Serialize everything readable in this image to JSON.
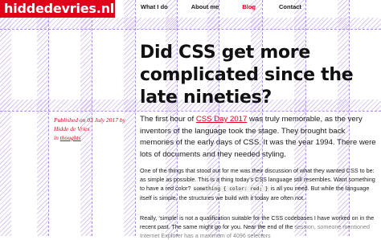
{
  "site": {
    "logo": "hiddedevries.nl"
  },
  "nav": {
    "items": [
      "What I do",
      "About me",
      "Blog",
      "Contact"
    ],
    "active": "Blog"
  },
  "article": {
    "title": "Did CSS get more complicated since the late nineties?",
    "meta": {
      "published_prefix": "Published on 03 July 2017 by Hidde de Vries",
      "category_prefix": "in ",
      "category": "thoughts"
    },
    "lead": {
      "before_link": "The first hour of ",
      "link": "CSS Day 2017",
      "after_link": " was truly memorable, as the very inventors of the language took the stage. They brought back memories of the early days of CSS. It was the year 1994. There were lots of documents and they needed styling."
    },
    "p2": {
      "before_code": "One of the things that stood out for me was their discussion of what they wanted CSS to be: as simple as possible. This is a thing today’s CSS language still resembles. Want something to have a red color? ",
      "code": "something { color: red; }",
      "after_code": " is all you need. But while the language itself is simple, the structures we build with it today are often not."
    },
    "p3": {
      "text": "Really, ‘simple’ is not a qualification suitable for the CSS codebases I have worked on in the recent past. The same might go for you. Near the end of the",
      "cut": "session, someone mentioned Internet Explorer has a maximum of 4096 selectors"
    }
  },
  "colors": {
    "accent": "#e0001a",
    "grid": "#9b7fe0"
  }
}
